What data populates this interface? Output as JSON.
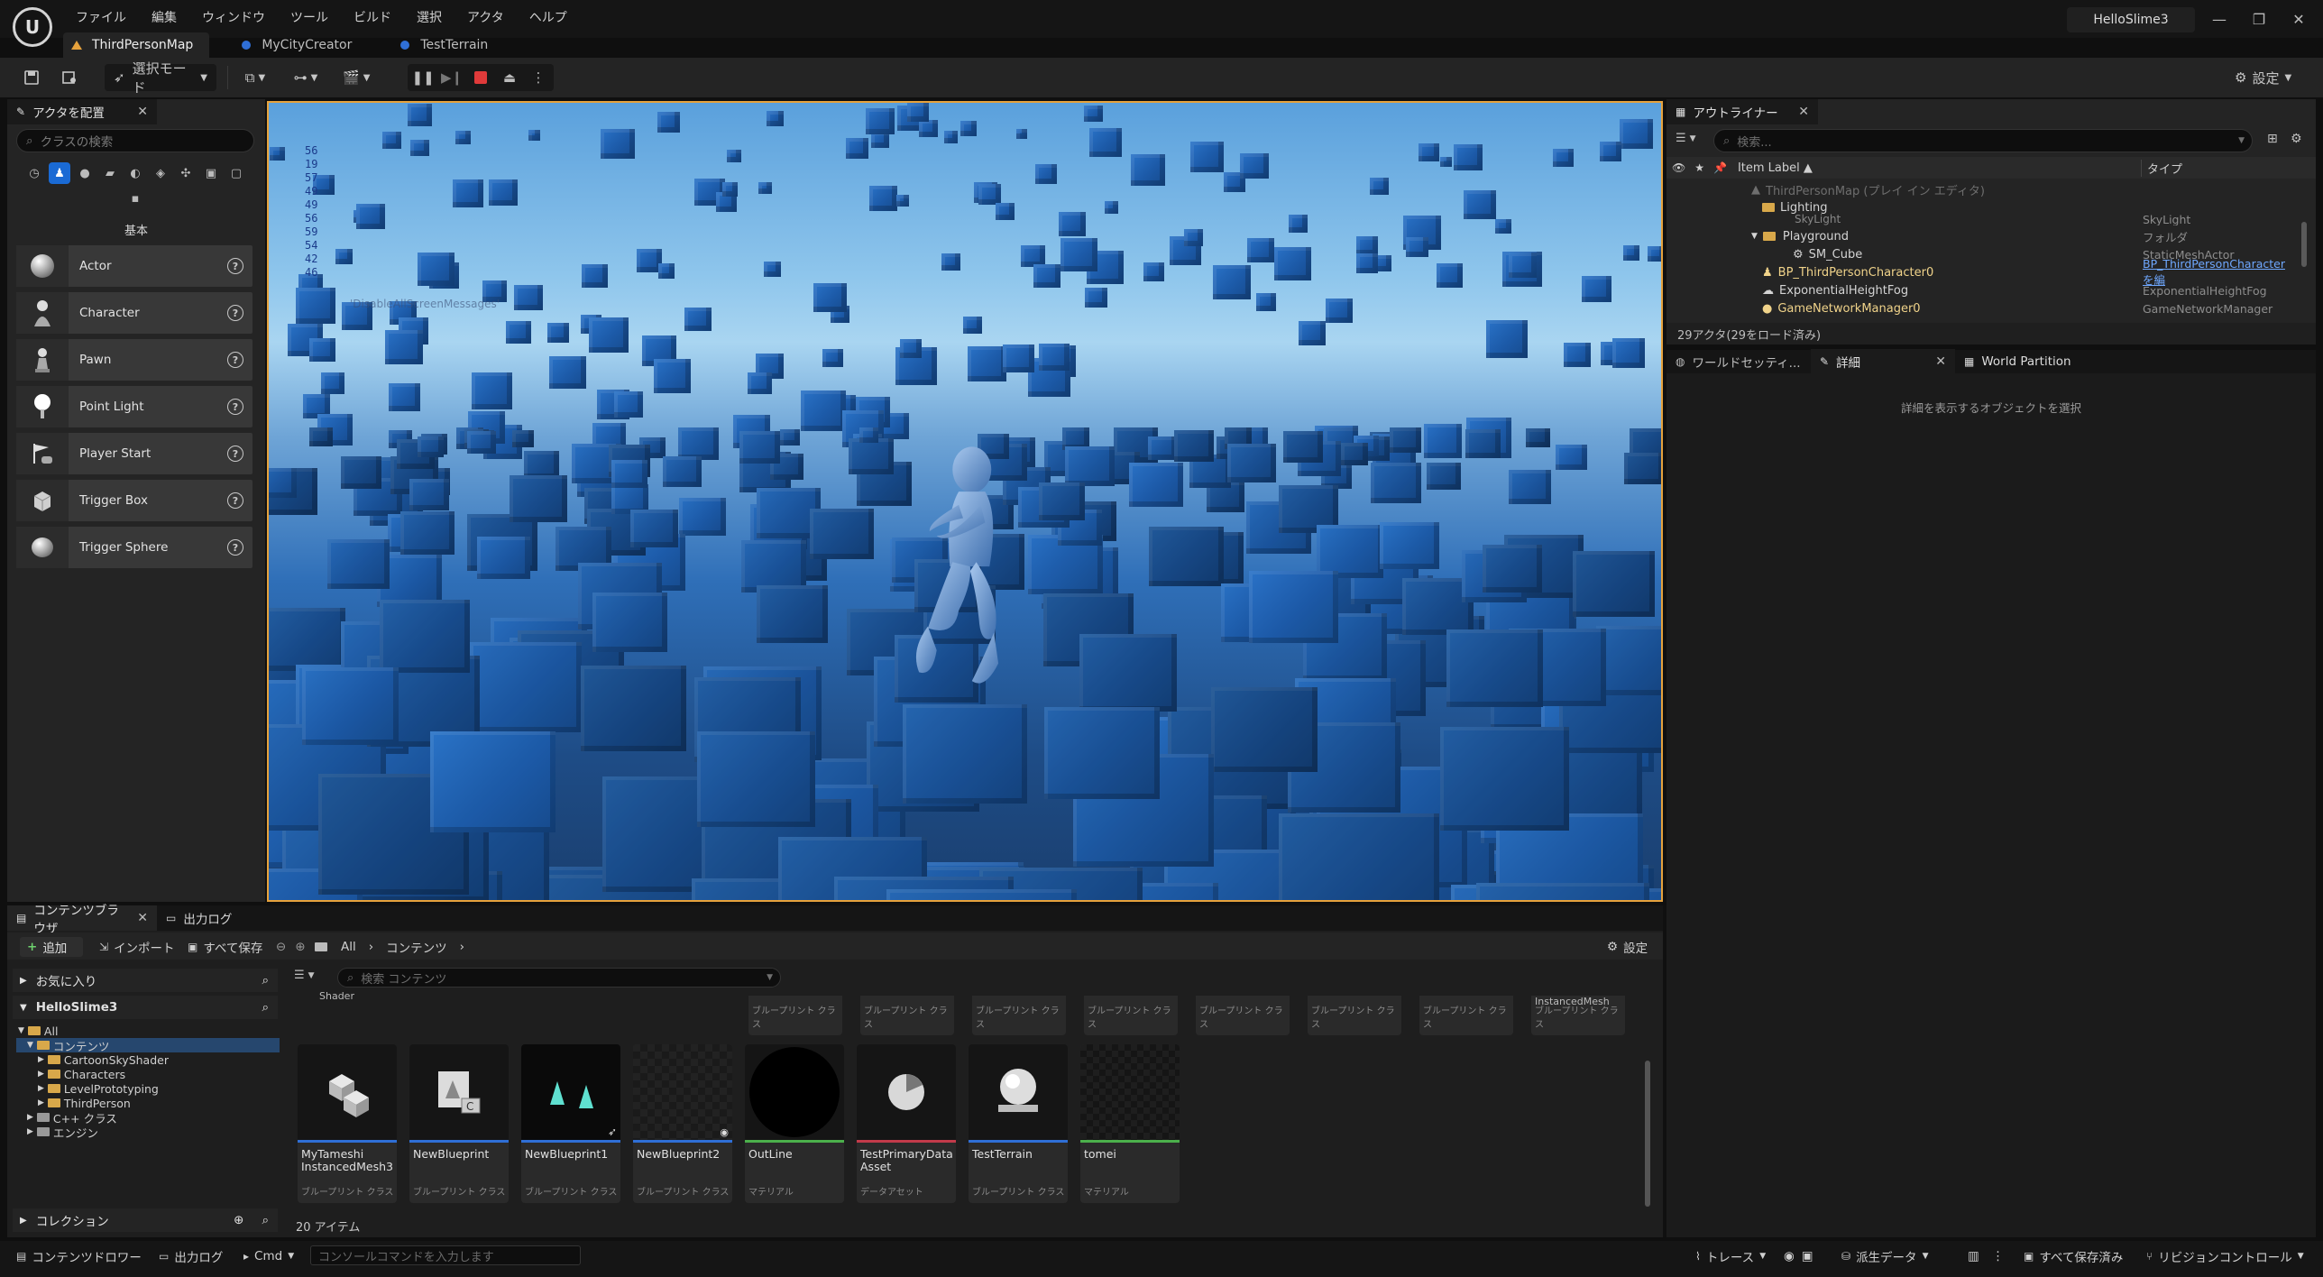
{
  "titlebar": {
    "menu": [
      "ファイル",
      "編集",
      "ウィンドウ",
      "ツール",
      "ビルド",
      "選択",
      "アクタ",
      "ヘルプ"
    ],
    "project_name": "HelloSlime3",
    "logo_text": "U"
  },
  "tabs": [
    {
      "label": "ThirdPersonMap",
      "active": true
    },
    {
      "label": "MyCityCreator",
      "active": false
    },
    {
      "label": "TestTerrain",
      "active": false
    }
  ],
  "toolbar": {
    "mode_label": "選択モード",
    "settings_label": "設定"
  },
  "place_actors": {
    "tab_label": "アクタを配置",
    "search_placeholder": "クラスの検索",
    "category_label": "基本",
    "items": [
      {
        "label": "Actor"
      },
      {
        "label": "Character"
      },
      {
        "label": "Pawn"
      },
      {
        "label": "Point Light"
      },
      {
        "label": "Player Start"
      },
      {
        "label": "Trigger Box"
      },
      {
        "label": "Trigger Sphere"
      }
    ]
  },
  "viewport": {
    "stats": [
      "56",
      "19",
      "57",
      "49",
      "49",
      "56",
      "59",
      "54",
      "42",
      "46"
    ],
    "debug_text": "'DisableAllScreenMessages'"
  },
  "outliner": {
    "tab_label": "アウトライナー",
    "search_placeholder": "検索...",
    "col_label": "Item Label ▲",
    "col_type": "タイプ",
    "rows": [
      {
        "label": "ThirdPersonMap (プレイ イン エディタ)",
        "type": ""
      },
      {
        "label": "Lighting",
        "type": ""
      },
      {
        "label": "SkyLight",
        "type": "SkyLight"
      },
      {
        "label": "Playground",
        "type": "フォルダ"
      },
      {
        "label": "SM_Cube",
        "type": "StaticMeshActor"
      },
      {
        "label": "BP_ThirdPersonCharacter0",
        "type": "BP_ThirdPersonCharacter を編"
      },
      {
        "label": "ExponentialHeightFog",
        "type": "ExponentialHeightFog"
      },
      {
        "label": "GameNetworkManager0",
        "type": "GameNetworkManager"
      }
    ],
    "status": "29アクタ(29をロード済み)"
  },
  "details": {
    "tabs": [
      "ワールドセッティ...",
      "詳細",
      "World Partition"
    ],
    "empty_text": "詳細を表示するオブジェクトを選択"
  },
  "content_browser": {
    "tabs": [
      "コンテンツブラウザ",
      "出力ログ"
    ],
    "add_label": "追加",
    "import_label": "インポート",
    "save_all_label": "すべて保存",
    "breadcrumb": [
      "All",
      "コンテンツ"
    ],
    "settings_label": "設定",
    "favorites_label": "お気に入り",
    "project_label": "HelloSlime3",
    "collections_label": "コレクション",
    "search_placeholder": "検索 コンテンツ",
    "tree": [
      {
        "label": "All",
        "depth": 0
      },
      {
        "label": "コンテンツ",
        "depth": 1
      },
      {
        "label": "CartoonSkyShader",
        "depth": 2
      },
      {
        "label": "Characters",
        "depth": 2
      },
      {
        "label": "LevelPrototyping",
        "depth": 2
      },
      {
        "label": "ThirdPerson",
        "depth": 2
      },
      {
        "label": "C++ クラス",
        "depth": 1
      },
      {
        "label": "エンジン",
        "depth": 1
      }
    ],
    "top_row": [
      {
        "name": "Shader",
        "type": ""
      },
      {
        "name": "",
        "type": "ブループリント クラス"
      },
      {
        "name": "",
        "type": "ブループリント クラス"
      },
      {
        "name": "",
        "type": "ブループリント クラス"
      },
      {
        "name": "",
        "type": "ブループリント クラス"
      },
      {
        "name": "",
        "type": "ブループリント クラス"
      },
      {
        "name": "",
        "type": "ブループリント クラス"
      },
      {
        "name": "",
        "type": "ブループリント クラス"
      },
      {
        "name": "InstancedMesh",
        "type": "ブループリント クラス"
      }
    ],
    "assets": [
      {
        "name": "MyTameshi InstancedMesh3",
        "type": "ブループリント クラス",
        "bar": "#2f6fd6"
      },
      {
        "name": "NewBlueprint",
        "type": "ブループリント クラス",
        "bar": "#2f6fd6"
      },
      {
        "name": "NewBlueprint1",
        "type": "ブループリント クラス",
        "bar": "#2f6fd6"
      },
      {
        "name": "NewBlueprint2",
        "type": "ブループリント クラス",
        "bar": "#2f6fd6"
      },
      {
        "name": "OutLine",
        "type": "マテリアル",
        "bar": "#4bb04b"
      },
      {
        "name": "TestPrimaryData Asset",
        "type": "データアセット",
        "bar": "#c23a4a"
      },
      {
        "name": "TestTerrain",
        "type": "ブループリント クラス",
        "bar": "#2f6fd6"
      },
      {
        "name": "tomei",
        "type": "マテリアル",
        "bar": "#4bb04b"
      }
    ],
    "item_count": "20 アイテム"
  },
  "statusbar": {
    "content_drawer": "コンテンツドロワー",
    "output_log": "出力ログ",
    "cmd": "Cmd",
    "console_placeholder": "コンソールコマンドを入力します",
    "trace": "トレース",
    "derived_data": "派生データ",
    "all_saved": "すべて保存済み",
    "source_control": "リビジョンコントロール"
  },
  "colors": {
    "accent_blue": "#1a6ad4",
    "viewport_border": "#e6a23c",
    "play_stop": "#e03a3a"
  }
}
